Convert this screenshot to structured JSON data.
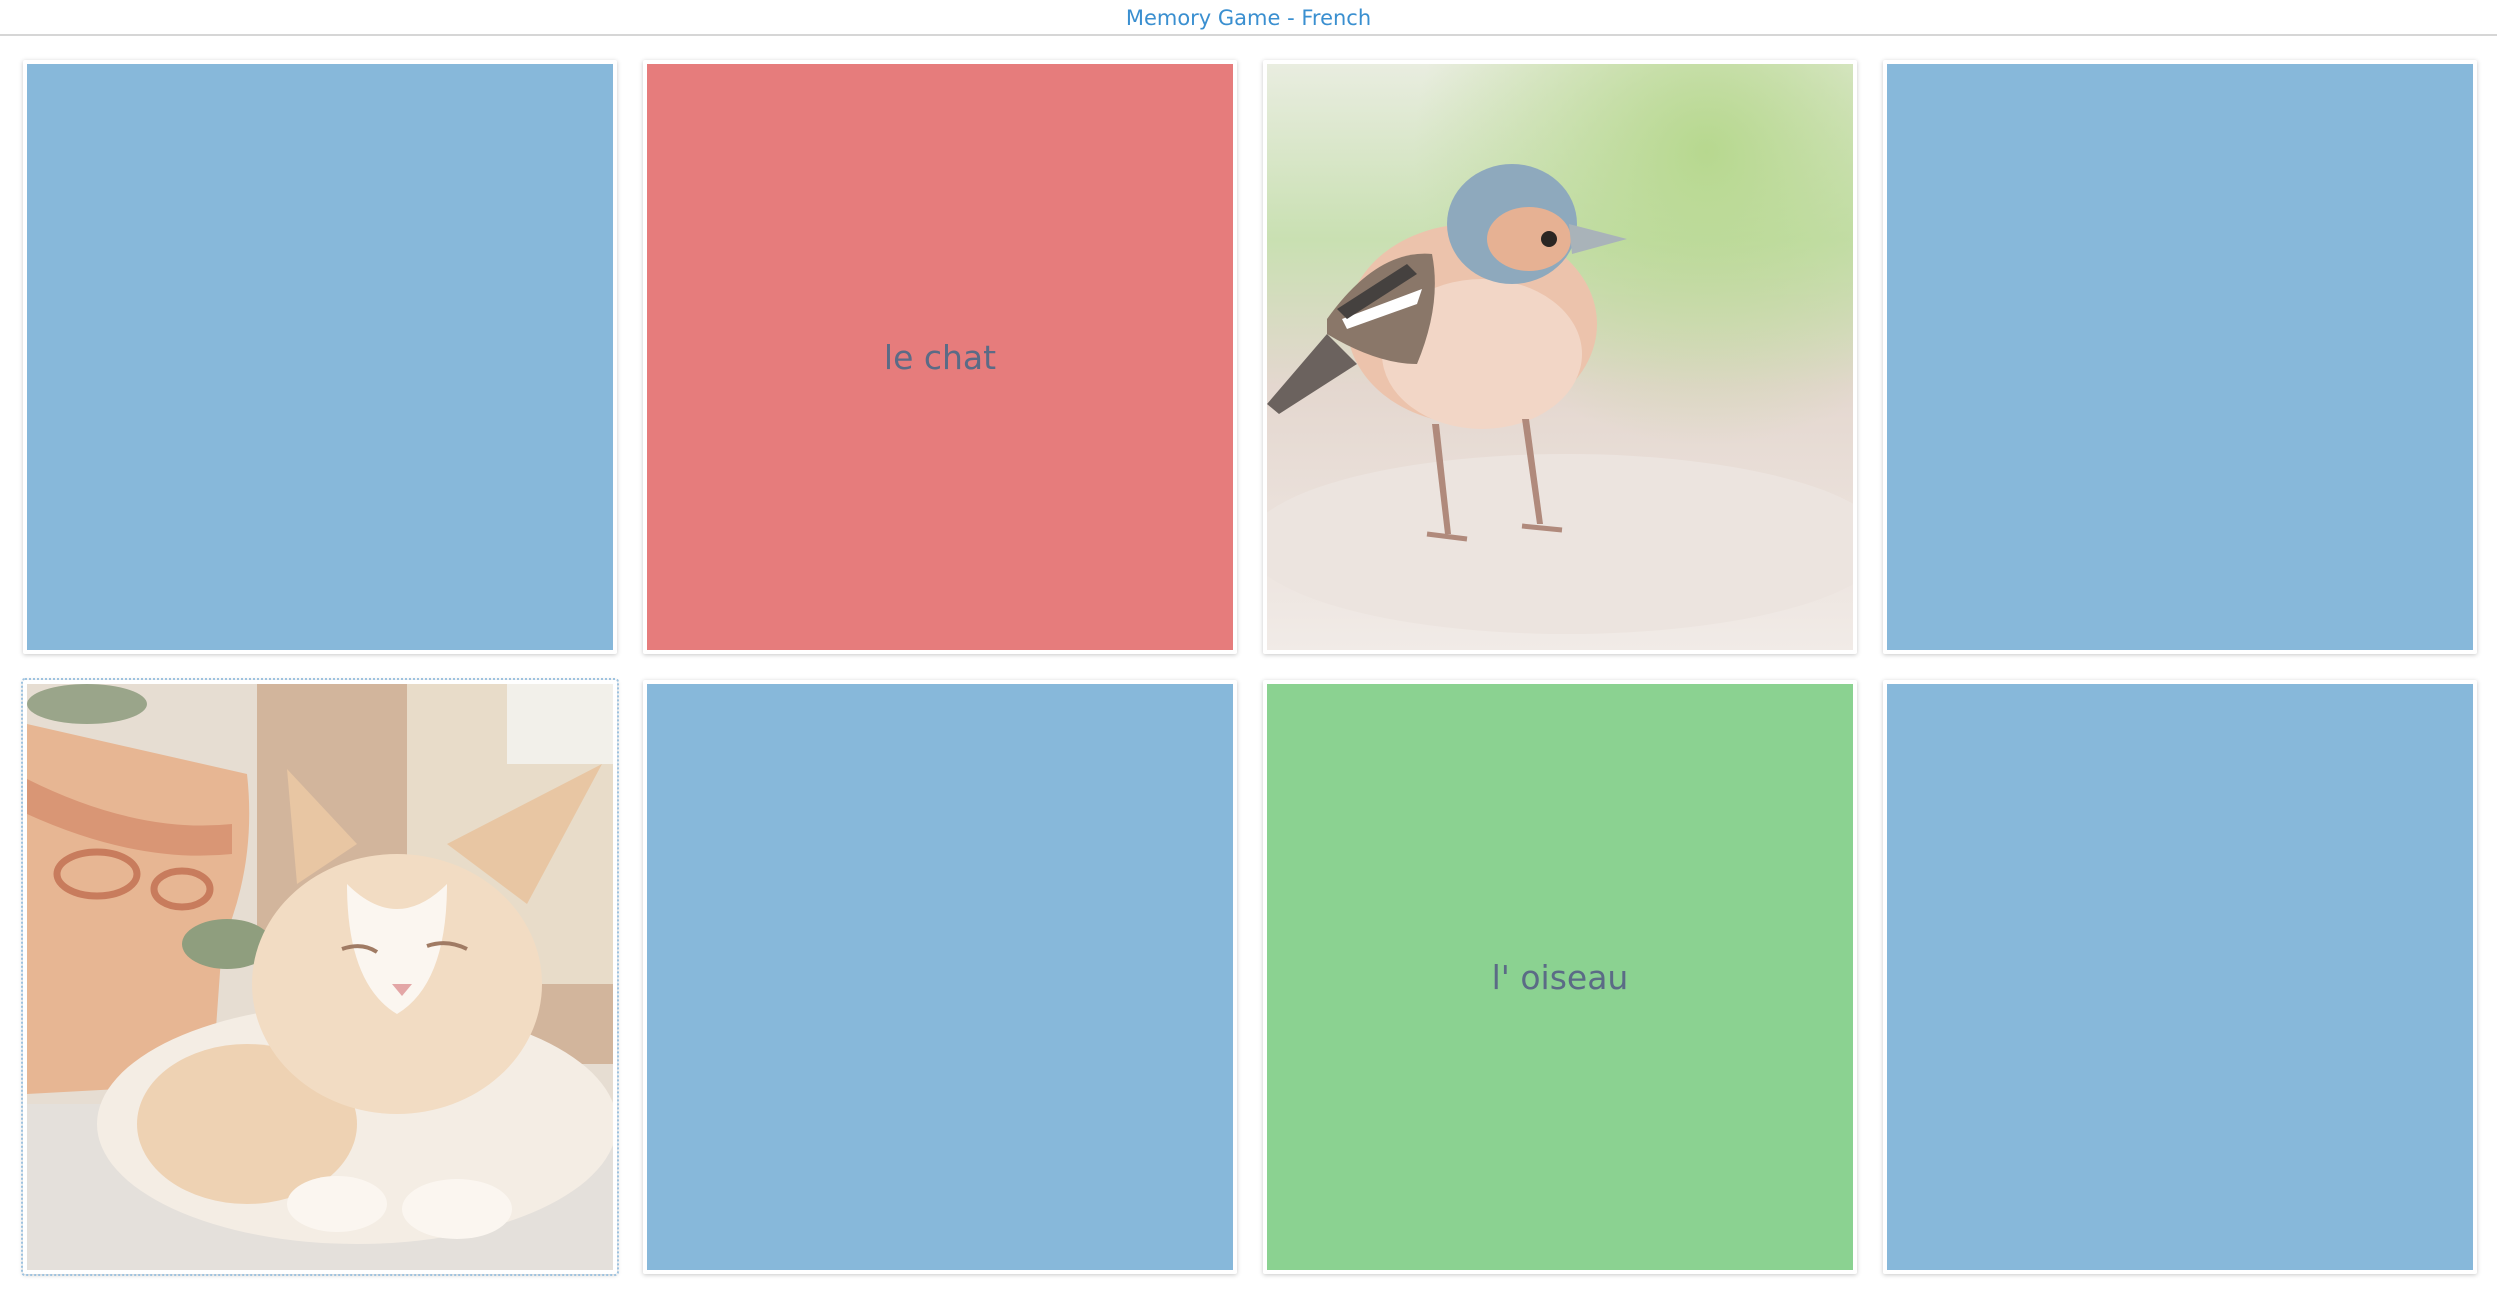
{
  "header": {
    "title": "Memory Game - French"
  },
  "colors": {
    "card_back": "#87b8da",
    "word_red": "#e67c7c",
    "word_green": "#8bd291",
    "accent": "#3a8fd0"
  },
  "cards": [
    {
      "kind": "hidden"
    },
    {
      "kind": "word",
      "text": "le chat",
      "color": "red"
    },
    {
      "kind": "image",
      "image": "bird-photo"
    },
    {
      "kind": "hidden"
    },
    {
      "kind": "image",
      "image": "cat-photo",
      "selected": true
    },
    {
      "kind": "hidden"
    },
    {
      "kind": "word",
      "text": "l' oiseau",
      "color": "green"
    },
    {
      "kind": "hidden"
    }
  ]
}
